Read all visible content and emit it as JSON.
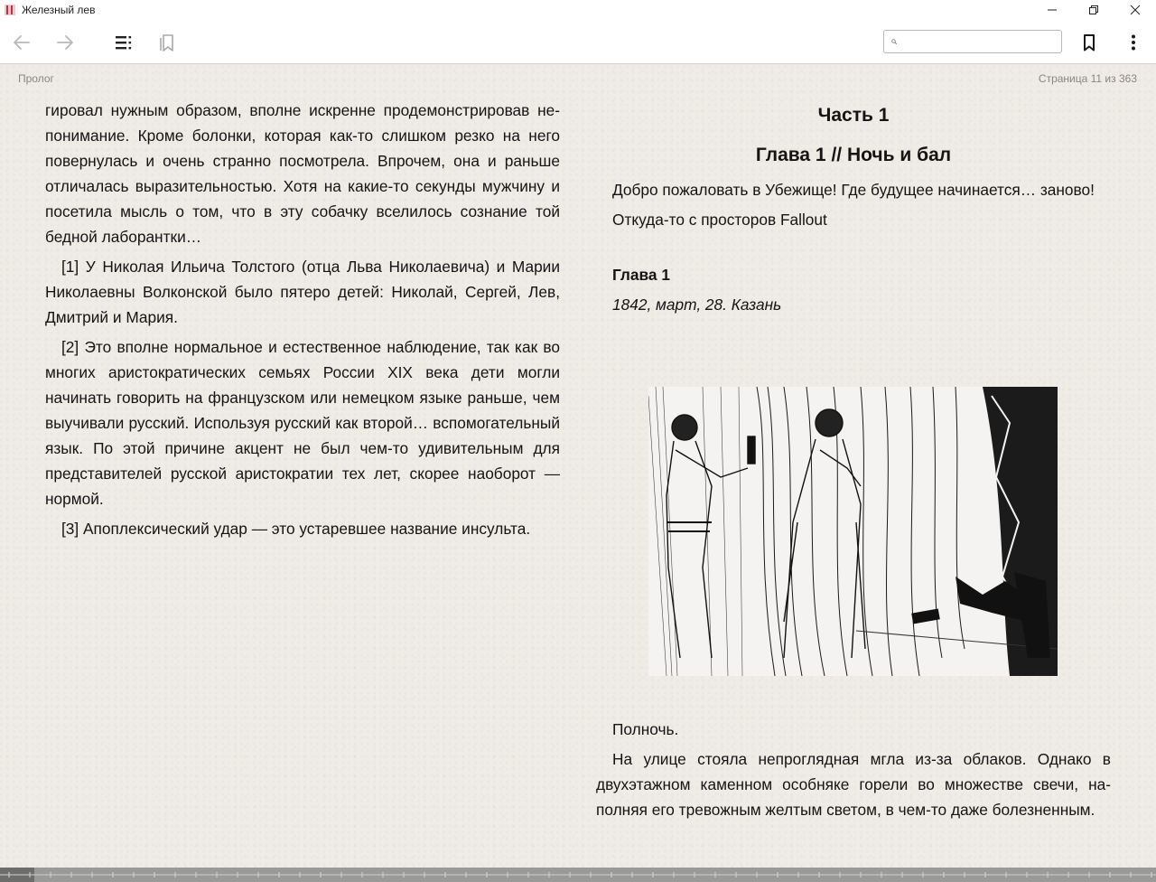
{
  "window": {
    "title": "Железный лев",
    "controls": [
      "minimize-icon",
      "restore-icon",
      "close-icon"
    ]
  },
  "toolbar": {
    "back_icon": "arrow-left-icon",
    "forward_icon": "arrow-right-icon",
    "toc_icon": "contents-list-icon",
    "bookmarks_icon": "bookmarks-list-icon",
    "search": {
      "value": "",
      "placeholder": ""
    },
    "bookmark_icon": "bookmark-icon",
    "menu_icon": "kebab-menu-icon"
  },
  "header": {
    "section": "Пролог",
    "page_info": "Страница 11 из 363"
  },
  "left_page": {
    "paragraphs": [
      {
        "indent": false,
        "text": "гировал нужным образом, вполне искренне продемонстрировав не­понимание. Кроме болонки, которая как-то слишком резко на него повернулась и очень странно посмотрела. Впрочем, она и раньше отличалась выразительностью. Хотя на какие-то секунды мужчину и посетила мысль о том, что в эту собачку вселилось сознание той бедной лаборантки…"
      },
      {
        "indent": true,
        "text": "[1] У Николая Ильича Толстого (отца Льва Николаевича) и Марии Николаевны Волконской было пятеро детей: Николай, Сергей, Лев, Дмитрий и Мария."
      },
      {
        "indent": true,
        "text": "[2] Это вполне нормальное и естественное наблюдение, так как во многих аристократических семьях России XIX века дети могли начинать говорить на французском или немецком языке раньше, чем выучивали русский. Используя русский как второй… вспомога­тельный язык. По этой причине акцент не был чем-то удивитель­ным для представителей русской аристократии тех лет, скорее нао­борот — нормой."
      },
      {
        "indent": true,
        "text": "[3] Апоплексический удар — это устаревшее название инсульта."
      }
    ]
  },
  "right_page": {
    "part_title": "Часть 1",
    "chapter_title": "Глава 1 // Ночь и бал",
    "intro": "Добро пожаловать в Убежище! Где будущее начинается… зано­во!",
    "source": "Откуда-то с просторов Fallout",
    "chapter_label": "Глава 1",
    "dateline": "1842, март, 28. Казань",
    "paragraphs": [
      "Полночь.",
      "На улице стояла непроглядная мгла из-за облаков. Однако в двухэтажном каменном особняке горели во множестве свечи, на­полняя его тревожным желтым светом, в чем-то даже болезнен­ным."
    ]
  },
  "progress": {
    "fraction": 0.03
  }
}
